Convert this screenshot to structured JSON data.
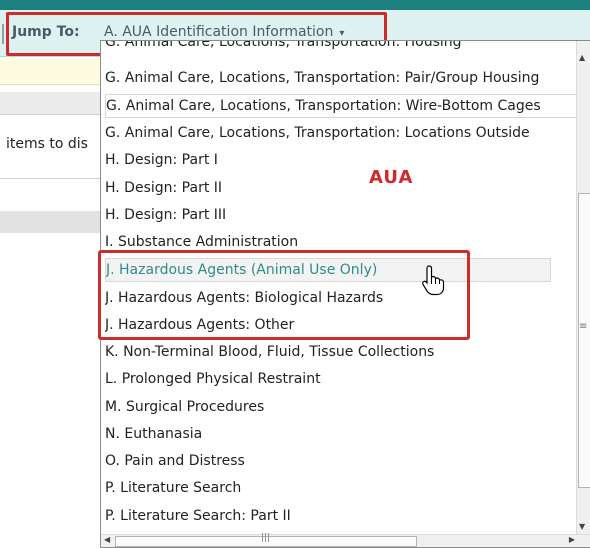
{
  "jump_bar": {
    "label": "Jump To:",
    "selected": "A. AUA Identification Information",
    "caret_icon": "chevron-down-icon"
  },
  "background": {
    "message_text": "items to dis"
  },
  "annotation": {
    "aua_label": "AUA",
    "color": "#d02a2a"
  },
  "dropdown": {
    "items": [
      "G. Animal Care, Locations, Transportation: Housing",
      "G. Animal Care, Locations, Transportation: Pair/Group Housing",
      "G. Animal Care, Locations, Transportation: Wire-Bottom Cages",
      "G. Animal Care, Locations, Transportation: Locations Outside",
      "H. Design: Part I",
      "H. Design: Part II",
      "H. Design:  Part III",
      "I. Substance Administration",
      "J. Hazardous Agents (Animal Use Only)",
      "J. Hazardous Agents: Biological Hazards",
      "J. Hazardous Agents: Other",
      "K. Non-Terminal Blood, Fluid, Tissue Collections",
      "L. Prolonged Physical Restraint",
      "M. Surgical Procedures",
      "N. Euthanasia",
      "O. Pain and Distress",
      "P. Literature Search",
      "P. Literature Search: Part II"
    ],
    "hovered_item": "J. Hazardous Agents (Animal Use Only)"
  },
  "colors": {
    "accent_teal": "#1e7f7f",
    "hover_text": "#2e8b8b"
  }
}
